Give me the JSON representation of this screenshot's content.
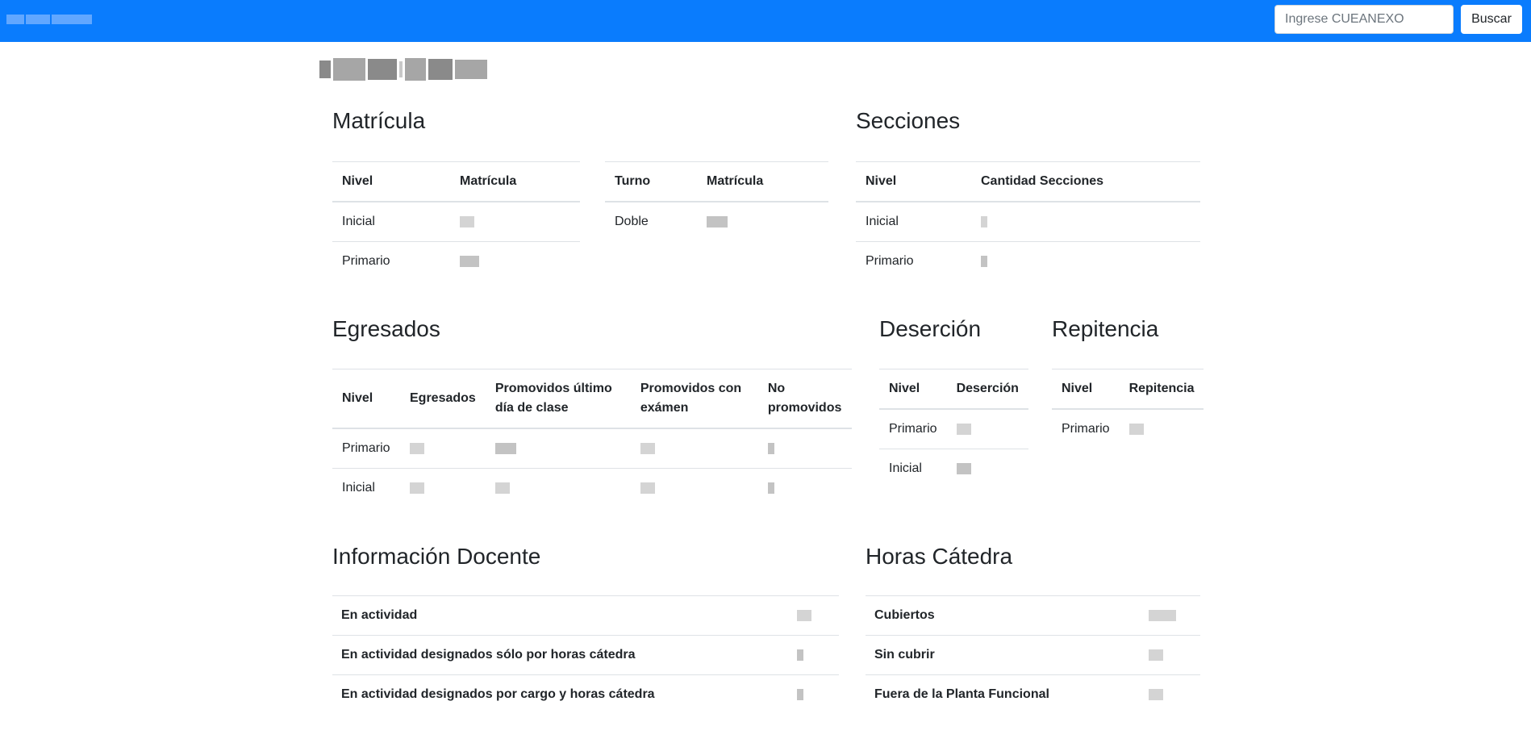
{
  "navbar": {
    "search_placeholder": "Ingrese CUEANEXO",
    "search_button": "Buscar"
  },
  "matricula": {
    "title": "Matrícula",
    "nivel_table": {
      "headers": [
        "Nivel",
        "Matrícula"
      ],
      "rows": [
        [
          "Inicial",
          ""
        ],
        [
          "Primario",
          ""
        ]
      ]
    },
    "turno_table": {
      "headers": [
        "Turno",
        "Matrícula"
      ],
      "rows": [
        [
          "Doble",
          ""
        ]
      ]
    }
  },
  "secciones": {
    "title": "Secciones",
    "headers": [
      "Nivel",
      "Cantidad Secciones"
    ],
    "rows": [
      [
        "Inicial",
        ""
      ],
      [
        "Primario",
        ""
      ]
    ]
  },
  "egresados": {
    "title": "Egresados",
    "headers": [
      "Nivel",
      "Egresados",
      "Promovidos último día de clase",
      "Promovidos con exámen",
      "No promovidos"
    ],
    "rows": [
      [
        "Primario",
        "",
        "",
        "",
        ""
      ],
      [
        "Inicial",
        "",
        "",
        "",
        ""
      ]
    ]
  },
  "desercion": {
    "title": "Deserción",
    "headers": [
      "Nivel",
      "Deserción"
    ],
    "rows": [
      [
        "Primario",
        ""
      ],
      [
        "Inicial",
        ""
      ]
    ]
  },
  "repitencia": {
    "title": "Repitencia",
    "headers": [
      "Nivel",
      "Repitencia"
    ],
    "rows": [
      [
        "Primario",
        ""
      ]
    ]
  },
  "docente": {
    "title": "Información Docente",
    "rows": [
      "En actividad",
      "En actividad designados sólo por horas cátedra",
      "En actividad designados por cargo y horas cátedra"
    ]
  },
  "horas": {
    "title": "Horas Cátedra",
    "rows": [
      "Cubiertos",
      "Sin cubrir",
      "Fuera de la Planta Funcional"
    ]
  }
}
